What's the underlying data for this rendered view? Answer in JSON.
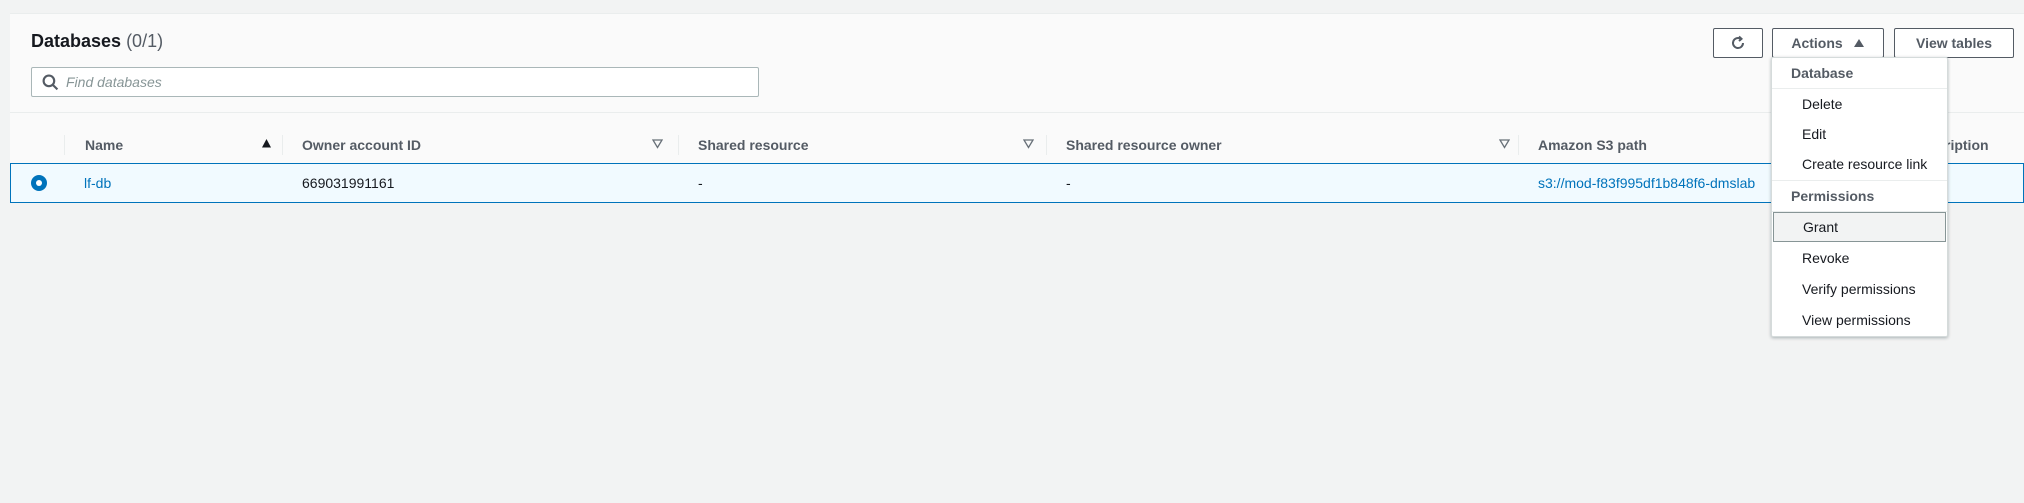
{
  "header": {
    "title": "Databases",
    "count": "(0/1)"
  },
  "search": {
    "placeholder": "Find databases",
    "value": ""
  },
  "toolbar": {
    "refresh_icon": "refresh-icon",
    "actions_label": "Actions",
    "view_tables_label": "View tables"
  },
  "table": {
    "columns": [
      {
        "label": "Name",
        "sort": "ascending"
      },
      {
        "label": "Owner account ID",
        "sort": "none"
      },
      {
        "label": "Shared resource",
        "sort": "none"
      },
      {
        "label": "Shared resource owner",
        "sort": "none"
      },
      {
        "label": "Amazon S3 path",
        "sort": "none"
      },
      {
        "label": "ription",
        "sort": "none"
      }
    ],
    "rows": [
      {
        "selected": true,
        "name": "lf-db",
        "owner_account_id": "669031991161",
        "shared_resource": "-",
        "shared_resource_owner": "-",
        "s3_path": "s3://mod-f83f995df1b848f6-dmslab"
      }
    ]
  },
  "actions_menu": {
    "groups": [
      {
        "label": "Database",
        "items": [
          {
            "label": "Delete"
          },
          {
            "label": "Edit"
          },
          {
            "label": "Create resource link"
          }
        ]
      },
      {
        "label": "Permissions",
        "items": [
          {
            "label": "Grant",
            "highlighted": true
          },
          {
            "label": "Revoke"
          },
          {
            "label": "Verify permissions"
          },
          {
            "label": "View permissions"
          }
        ]
      }
    ]
  },
  "colors": {
    "link": "#0073bb",
    "selected_row_bg": "#f1faff",
    "selected_row_border": "#0073bb",
    "page_bg": "#f2f3f3"
  }
}
